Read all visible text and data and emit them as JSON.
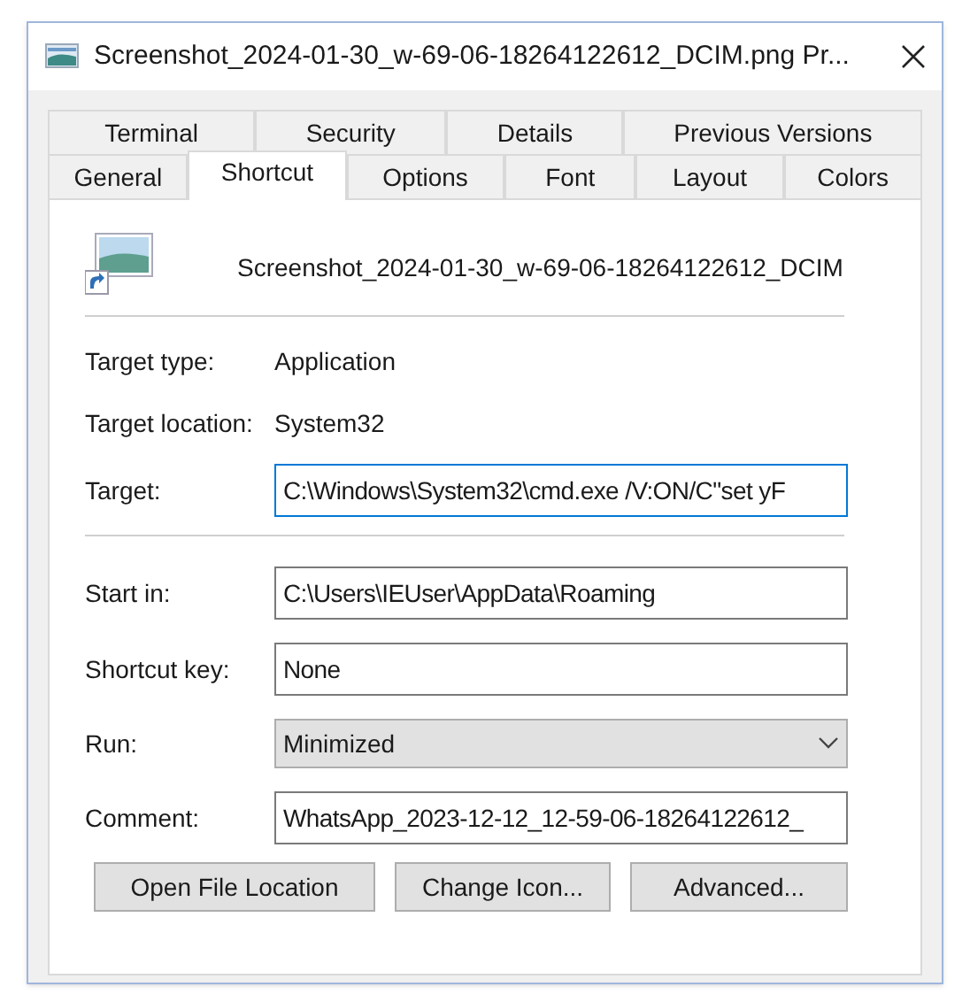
{
  "window": {
    "title": "Screenshot_2024-01-30_w-69-06-18264122612_DCIM.png Pr..."
  },
  "tab_rows": [
    [
      {
        "label": "Terminal",
        "selected": false
      },
      {
        "label": "Security",
        "selected": false
      },
      {
        "label": "Details",
        "selected": false
      },
      {
        "label": "Previous Versions",
        "selected": false
      }
    ],
    [
      {
        "label": "General",
        "selected": false
      },
      {
        "label": "Shortcut",
        "selected": true
      },
      {
        "label": "Options",
        "selected": false
      },
      {
        "label": "Font",
        "selected": false
      },
      {
        "label": "Layout",
        "selected": false
      },
      {
        "label": "Colors",
        "selected": false
      }
    ]
  ],
  "file_name": "Screenshot_2024-01-30_w-69-06-18264122612_DCIM",
  "info": [
    {
      "label": "Target type:",
      "value": "Application"
    },
    {
      "label": "Target location:",
      "value": "System32"
    }
  ],
  "target": {
    "label": "Target:",
    "value": "C:\\Windows\\System32\\cmd.exe /V:ON/C\"set yF",
    "focused": true
  },
  "fields": [
    {
      "kind": "text",
      "label": "Start in:",
      "value": "C:\\Users\\IEUser\\AppData\\Roaming"
    },
    {
      "kind": "text",
      "label": "Shortcut key:",
      "value": "None"
    },
    {
      "kind": "dropdown",
      "label": "Run:",
      "value": "Minimized"
    },
    {
      "kind": "text",
      "label": "Comment:",
      "value": "WhatsApp_2023-12-12_12-59-06-18264122612_"
    }
  ],
  "buttons": [
    "Open File Location",
    "Change Icon...",
    "Advanced..."
  ]
}
